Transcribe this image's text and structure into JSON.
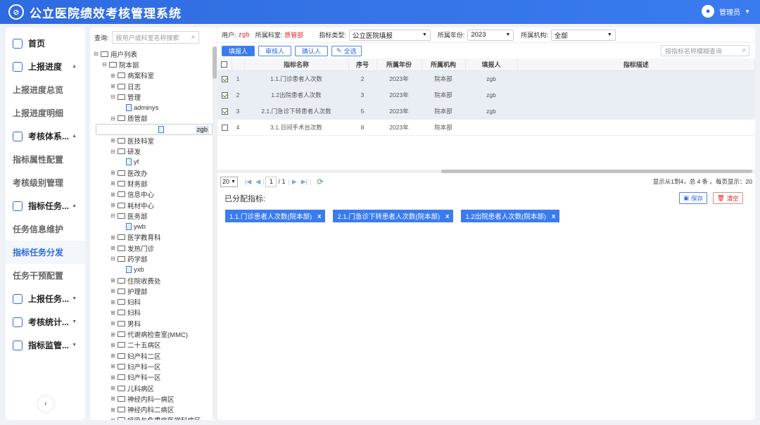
{
  "app": {
    "title": "公立医院绩效考核管理系统",
    "user": "管理员"
  },
  "nav": [
    {
      "type": "group",
      "label": "首页",
      "icon": "clock-icon",
      "arrow": ""
    },
    {
      "type": "group",
      "label": "上报进度",
      "icon": "clipboard-icon",
      "arrow": "▲"
    },
    {
      "type": "sub",
      "label": "上报进度总览"
    },
    {
      "type": "sub",
      "label": "上报进度明细"
    },
    {
      "type": "group",
      "label": "考核体系...",
      "icon": "monitor-icon",
      "arrow": "▲"
    },
    {
      "type": "sub",
      "label": "指标属性配置"
    },
    {
      "type": "sub",
      "label": "考核级别管理"
    },
    {
      "type": "group",
      "label": "指标任务...",
      "icon": "document-icon",
      "arrow": "▲"
    },
    {
      "type": "sub",
      "label": "任务信息维护"
    },
    {
      "type": "sub",
      "label": "指标任务分发",
      "active": true
    },
    {
      "type": "sub",
      "label": "任务干预配置"
    },
    {
      "type": "group",
      "label": "上报任务...",
      "icon": "chart-icon",
      "arrow": "▼"
    },
    {
      "type": "group",
      "label": "考核统计...",
      "icon": "stats-icon",
      "arrow": "▼"
    },
    {
      "type": "group",
      "label": "指标监管...",
      "icon": "clock-icon",
      "arrow": "▼"
    }
  ],
  "tree_search": {
    "label": "查询:",
    "placeholder": "按用户或科室名称搜索"
  },
  "tree": [
    {
      "lv": 0,
      "t": "f",
      "tog": "⊟",
      "label": "用户列表"
    },
    {
      "lv": 1,
      "t": "f",
      "tog": "⊟",
      "label": "院本部"
    },
    {
      "lv": 2,
      "t": "f",
      "tog": "⊞",
      "label": "病案科室"
    },
    {
      "lv": 2,
      "t": "f",
      "tog": "⊞",
      "label": "日志"
    },
    {
      "lv": 2,
      "t": "f",
      "tog": "⊟",
      "label": "管理"
    },
    {
      "lv": 3,
      "t": "u",
      "label": "adminys"
    },
    {
      "lv": 2,
      "t": "f",
      "tog": "⊟",
      "label": "质管部"
    },
    {
      "lv": 3,
      "t": "u",
      "label": "zgb",
      "sel": true
    },
    {
      "lv": 2,
      "t": "f",
      "tog": "⊞",
      "label": "医技科室"
    },
    {
      "lv": 2,
      "t": "f",
      "tog": "⊟",
      "label": "研发"
    },
    {
      "lv": 3,
      "t": "u",
      "label": "yf"
    },
    {
      "lv": 2,
      "t": "f",
      "tog": "⊞",
      "label": "医改办"
    },
    {
      "lv": 2,
      "t": "f",
      "tog": "⊞",
      "label": "财务部"
    },
    {
      "lv": 2,
      "t": "f",
      "tog": "⊞",
      "label": "信息中心"
    },
    {
      "lv": 2,
      "t": "f",
      "tog": "⊞",
      "label": "耗材中心"
    },
    {
      "lv": 2,
      "t": "f",
      "tog": "⊟",
      "label": "医务部"
    },
    {
      "lv": 3,
      "t": "u",
      "label": "ywb"
    },
    {
      "lv": 2,
      "t": "f",
      "tog": "⊞",
      "label": "医学教育科"
    },
    {
      "lv": 2,
      "t": "f",
      "tog": "⊞",
      "label": "发热门诊"
    },
    {
      "lv": 2,
      "t": "f",
      "tog": "⊟",
      "label": "药学部"
    },
    {
      "lv": 3,
      "t": "u",
      "label": "yxb"
    },
    {
      "lv": 2,
      "t": "f",
      "tog": "⊞",
      "label": "住院收费处"
    },
    {
      "lv": 2,
      "t": "f",
      "tog": "⊞",
      "label": "护理部"
    },
    {
      "lv": 2,
      "t": "f",
      "tog": "⊞",
      "label": "妇科"
    },
    {
      "lv": 2,
      "t": "f",
      "tog": "⊞",
      "label": "妇科"
    },
    {
      "lv": 2,
      "t": "f",
      "tog": "⊞",
      "label": "男科"
    },
    {
      "lv": 2,
      "t": "f",
      "tog": "⊞",
      "label": "代谢病检查室(MMC)"
    },
    {
      "lv": 2,
      "t": "f",
      "tog": "⊞",
      "label": "二十五病区"
    },
    {
      "lv": 2,
      "t": "f",
      "tog": "⊞",
      "label": "妇产科二区"
    },
    {
      "lv": 2,
      "t": "f",
      "tog": "⊞",
      "label": "妇产科一区"
    },
    {
      "lv": 2,
      "t": "f",
      "tog": "⊞",
      "label": "妇产科一区"
    },
    {
      "lv": 2,
      "t": "f",
      "tog": "⊞",
      "label": "儿科病区"
    },
    {
      "lv": 2,
      "t": "f",
      "tog": "⊞",
      "label": "神经内科一病区"
    },
    {
      "lv": 2,
      "t": "f",
      "tog": "⊞",
      "label": "神经内科二病区"
    },
    {
      "lv": 2,
      "t": "f",
      "tog": "⊞",
      "label": "呼吸与危重症医学科病区"
    }
  ],
  "filters": {
    "user_label": "用户:",
    "user": "zgb",
    "dept_label": "所属科室:",
    "dept": "质管部",
    "type_label": "指标类型:",
    "type": "公立医院填报",
    "year_label": "所属年份:",
    "year": "2023",
    "org_label": "所属机构:",
    "org": "全部"
  },
  "toolbar": {
    "b1": "填报人",
    "b2": "审核人",
    "b3": "确认人",
    "b4": "全选",
    "search_placeholder": "按指标名称模糊查询"
  },
  "table": {
    "headers": [
      "指标名称",
      "序号",
      "所属年份",
      "所属机构",
      "填报人",
      "指标描述"
    ],
    "rows": [
      {
        "checked": true,
        "n": "1",
        "name": "1.1.门诊患者人次数",
        "seq": "2",
        "year": "2023年",
        "org": "院本部",
        "filler": "zgb"
      },
      {
        "checked": true,
        "n": "2",
        "name": "1.2出院患者人次数",
        "seq": "3",
        "year": "2023年",
        "org": "院本部",
        "filler": "zgb"
      },
      {
        "checked": true,
        "n": "3",
        "name": "2.1.门急诊下转患者人次数",
        "seq": "5",
        "year": "2023年",
        "org": "院本部",
        "filler": "zgb"
      },
      {
        "checked": false,
        "n": "4",
        "name": "3.1.日间手术台次数",
        "seq": "8",
        "year": "2023年",
        "org": "院本部",
        "filler": ""
      }
    ]
  },
  "pager": {
    "size": "20",
    "page": "1",
    "total": "/ 1",
    "info": "显示从1到4，总 4 条 。每页显示：20"
  },
  "assigned": {
    "label": "已分配指标:",
    "save": "保存",
    "clear": "清空",
    "tags": [
      "1.1.门诊患者人次数(院本部)",
      "2.1.门急诊下转患者人次数(院本部)",
      "1.2出院患者人次数(院本部)"
    ]
  }
}
